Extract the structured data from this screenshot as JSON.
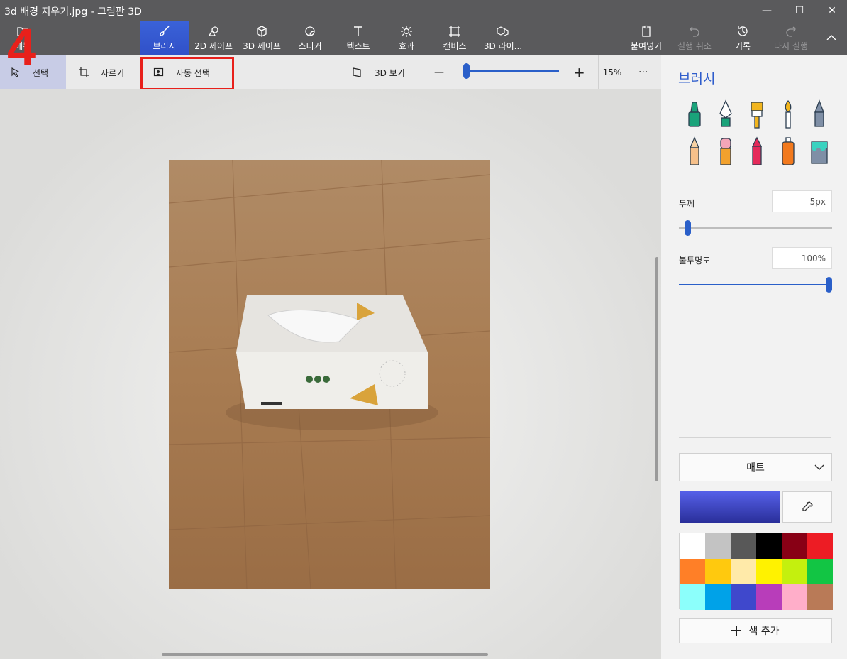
{
  "window": {
    "title": "3d 배경 지우기.jpg - 그림판 3D",
    "minimize": "—",
    "maximize": "☐",
    "close": "✕"
  },
  "step_marker": "4",
  "ribbon": {
    "menu_label": "메뉴",
    "items": [
      {
        "label": "브러시",
        "icon": "brush-icon"
      },
      {
        "label": "2D 셰이프",
        "icon": "shapes-2d-icon"
      },
      {
        "label": "3D 셰이프",
        "icon": "cube-icon"
      },
      {
        "label": "스티커",
        "icon": "sticker-icon"
      },
      {
        "label": "텍스트",
        "icon": "text-icon"
      },
      {
        "label": "효과",
        "icon": "sun-icon"
      },
      {
        "label": "캔버스",
        "icon": "canvas-icon"
      },
      {
        "label": "3D 라이...",
        "icon": "library-icon"
      }
    ],
    "right": [
      {
        "label": "붙여넣기",
        "icon": "paste-icon"
      },
      {
        "label": "실행 취소",
        "icon": "undo-icon"
      },
      {
        "label": "기록",
        "icon": "history-icon"
      },
      {
        "label": "다시 실행",
        "icon": "redo-icon"
      }
    ]
  },
  "subtoolbar": {
    "select_label": "선택",
    "crop_label": "자르기",
    "magic_select_label": "자동 선택",
    "view3d_label": "3D 보기",
    "zoom_minus": "—",
    "zoom_plus": "+",
    "zoom_percent": "15%",
    "more": "···",
    "zoom_fraction": 0.02
  },
  "panel": {
    "title": "브러시",
    "tools": [
      "marker-icon",
      "calligraphy-pen-icon",
      "oil-brush-icon",
      "watercolor-icon",
      "pixel-pen-icon",
      "pencil-icon",
      "eraser-icon",
      "crayon-icon",
      "spray-can-icon",
      "fill-icon"
    ],
    "thickness_label": "두께",
    "thickness_value": "5px",
    "thickness_fraction": 0.04,
    "opacity_label": "불투명도",
    "opacity_value": "100%",
    "opacity_fraction": 1.0,
    "finish_label": "매트",
    "add_color_label": "색 추가",
    "current_color": "#3d43c2",
    "palette": [
      "#ffffff",
      "#c3c3c3",
      "#585858",
      "#000000",
      "#880015",
      "#ed1c24",
      "#ff7f27",
      "#ffc90e",
      "#ffeaa9",
      "#fff200",
      "#c4f00e",
      "#12c544",
      "#8cfffb",
      "#00a2e8",
      "#3f48cc",
      "#b83dba",
      "#ffaec9",
      "#b97a57"
    ]
  }
}
